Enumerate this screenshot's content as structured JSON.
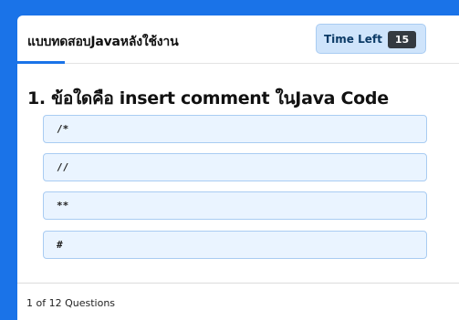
{
  "header": {
    "title": "แบบทดสอบJavaหลังใช้งาน",
    "timer_label": "Time Left",
    "timer_value": "15"
  },
  "question": {
    "text": "1. ข้อใดคือ insert comment ในJava Code"
  },
  "options": [
    {
      "label": "/*"
    },
    {
      "label": "//"
    },
    {
      "label": "**"
    },
    {
      "label": "#"
    }
  ],
  "footer": {
    "progress": "1 of 12 Questions"
  },
  "colors": {
    "accent": "#1a73e8",
    "option_bg": "#eaf4ff",
    "option_border": "#a9ccf2",
    "timer_bg": "#cfe4fb",
    "timer_badge": "#343a40"
  }
}
